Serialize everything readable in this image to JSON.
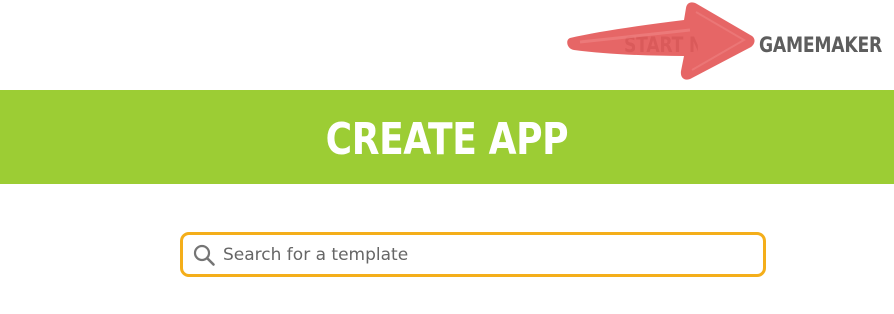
{
  "nav": {
    "start_label": "START NOW",
    "gamemaker_label": "GAMEMAKER"
  },
  "banner": {
    "title": "CREATE APP"
  },
  "search": {
    "placeholder": "Search for a template",
    "value": "",
    "icon": "search-icon"
  },
  "annotation": {
    "icon": "red-arrow-icon"
  },
  "colors": {
    "banner": "#9ccd34",
    "search_border": "#f4ae1a",
    "nav_text": "#5d5d5d",
    "arrow": "#e45a5a"
  }
}
